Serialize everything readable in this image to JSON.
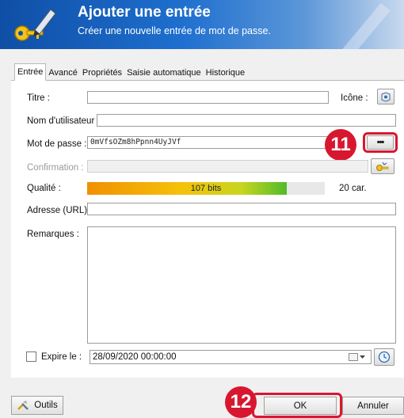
{
  "header": {
    "title": "Ajouter une entrée",
    "subtitle": "Créer une nouvelle entrée de mot de passe."
  },
  "tabs": [
    {
      "label": "Entrée",
      "active": true
    },
    {
      "label": "Avancé"
    },
    {
      "label": "Propriétés"
    },
    {
      "label": "Saisie automatique"
    },
    {
      "label": "Historique"
    }
  ],
  "form": {
    "title_label": "Titre :",
    "title_value": "",
    "icon_label": "Icône :",
    "username_label": "Nom d'utilisateur :",
    "username_value": "",
    "password_label": "Mot de passe :",
    "password_value": "0mVfsOZm8hPpnn4UyJVf",
    "confirmation_label": "Confirmation :",
    "quality_label": "Qualité :",
    "quality_text": "107 bits",
    "quality_fraction": 0.84,
    "char_count": "20 car.",
    "url_label": "Adresse (URL) :",
    "url_value": "",
    "notes_label": "Remarques :",
    "expire_label": "Expire le :",
    "expire_value": "28/09/2020 00:00:00",
    "expire_checked": false,
    "show_password_button": "•••"
  },
  "footer": {
    "tools_label": "Outils",
    "ok_label": "OK",
    "cancel_label": "Annuler"
  },
  "callouts": {
    "first": "11",
    "second": "12"
  },
  "colors": {
    "header_blue": "#1e6fcf",
    "callout_red": "#d7172f",
    "quality_start": "#f09000",
    "quality_end": "#4fbb2a"
  },
  "icons": [
    "key-icon",
    "pencil-icon",
    "entry-icon",
    "password-generator-icon",
    "clock-icon",
    "tools-icon",
    "dropdown-icon"
  ]
}
